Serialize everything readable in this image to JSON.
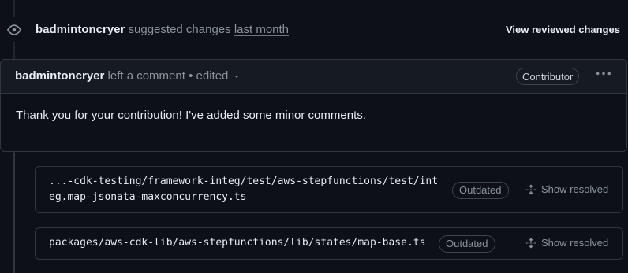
{
  "review": {
    "author": "badmintoncryer",
    "action": "suggested changes",
    "when": "last month",
    "view_reviewed_label": "View reviewed changes"
  },
  "comment": {
    "author": "badmintoncryer",
    "action": "left a comment",
    "separator": "•",
    "edited_label": "edited",
    "role_badge": "Contributor",
    "body": "Thank you for your contribution! I've added some minor comments."
  },
  "threads": [
    {
      "path_line1": "...-cdk-testing/framework-integ/test/aws-stepfunctions/test/int",
      "path_line2": "eg.map-jsonata-maxconcurrency.ts",
      "status": "Outdated",
      "action_label": "Show resolved"
    },
    {
      "path": "packages/aws-cdk-lib/aws-stepfunctions/lib/states/map-base.ts",
      "status": "Outdated",
      "action_label": "Show resolved"
    }
  ],
  "icons": {
    "review": "eye-icon",
    "menu": "kebab-horizontal-icon",
    "caret": "triangle-down-icon",
    "resolve": "unfold-icon"
  },
  "colors": {
    "background": "#0d1117",
    "header_background": "#161b22",
    "border": "#30363d",
    "text": "#e6edf3",
    "muted": "#8b949e"
  }
}
